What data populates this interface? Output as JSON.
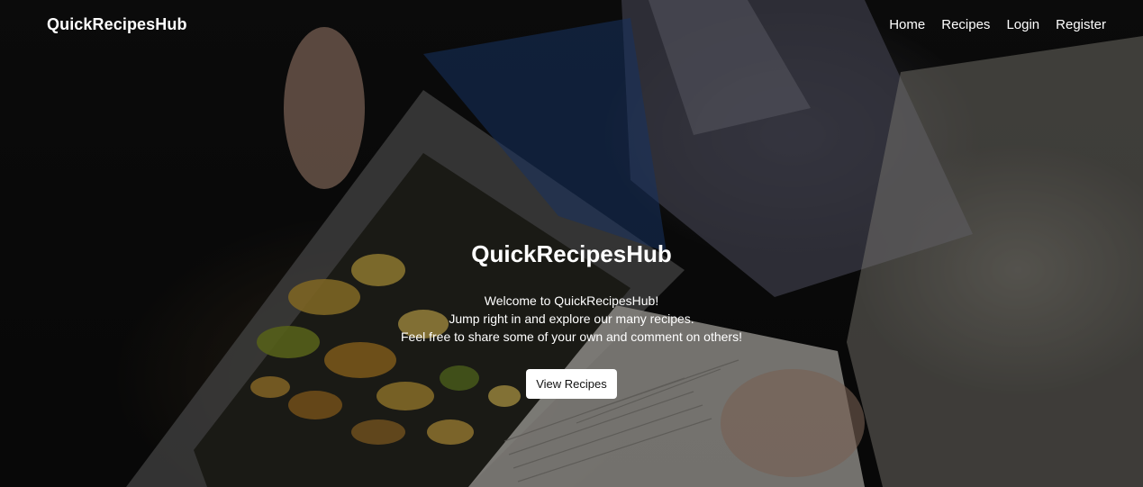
{
  "navbar": {
    "brand": "QuickRecipesHub",
    "links": [
      {
        "label": "Home"
      },
      {
        "label": "Recipes"
      },
      {
        "label": "Login"
      },
      {
        "label": "Register"
      }
    ]
  },
  "hero": {
    "title": "QuickRecipesHub",
    "lines": [
      "Welcome to QuickRecipesHub!",
      "Jump right in and explore our many recipes.",
      "Feel free to share some of your own and comment on others!"
    ],
    "button_label": "View Recipes"
  },
  "colors": {
    "text": "#ffffff",
    "button_bg": "#ffffff",
    "button_text": "#111111"
  }
}
